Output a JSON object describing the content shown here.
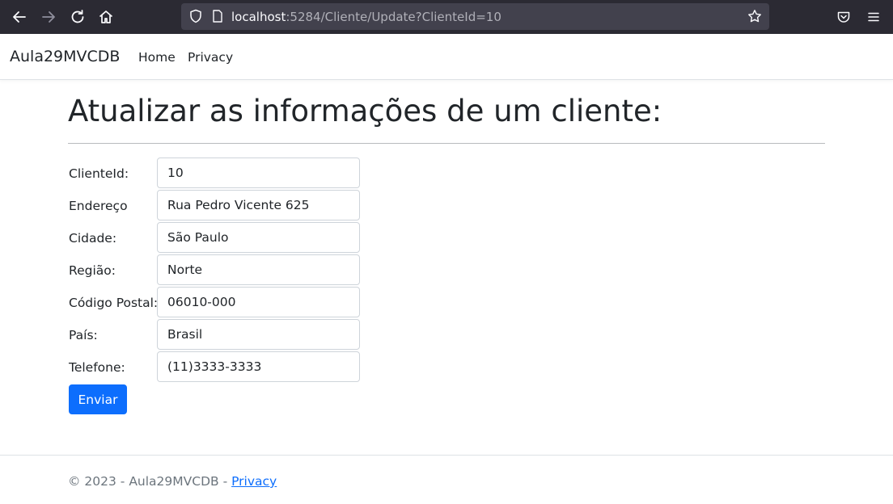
{
  "browser": {
    "url_host": "localhost",
    "url_rest": ":5284/Cliente/Update?ClienteId=10",
    "icons": {
      "back": "arrow-left-icon",
      "forward": "arrow-right-icon",
      "reload": "reload-icon",
      "home": "home-icon",
      "shield": "shield-icon",
      "page": "page-icon",
      "bookmark": "star-icon",
      "pocket": "pocket-icon",
      "menu": "hamburger-menu-icon"
    }
  },
  "navbar": {
    "brand": "Aula29MVCDB",
    "links": [
      "Home",
      "Privacy"
    ]
  },
  "page": {
    "title": "Atualizar as informações de um cliente:"
  },
  "form": {
    "fields": [
      {
        "label": "ClienteId:",
        "value": "10"
      },
      {
        "label": "Endereço",
        "value": "Rua Pedro Vicente 625"
      },
      {
        "label": "Cidade:",
        "value": "São Paulo"
      },
      {
        "label": "Região:",
        "value": "Norte"
      },
      {
        "label": "Código Postal:",
        "value": "06010-000"
      },
      {
        "label": "País:",
        "value": "Brasil"
      },
      {
        "label": "Telefone:",
        "value": "(11)3333-3333"
      }
    ],
    "submit_label": "Enviar"
  },
  "footer": {
    "text": "© 2023 - Aula29MVCDB - ",
    "link": "Privacy"
  },
  "colors": {
    "primary": "#0d6efd",
    "chrome_bg": "#2b2a33",
    "urlbar_bg": "#42414d",
    "muted": "#6c757d"
  }
}
